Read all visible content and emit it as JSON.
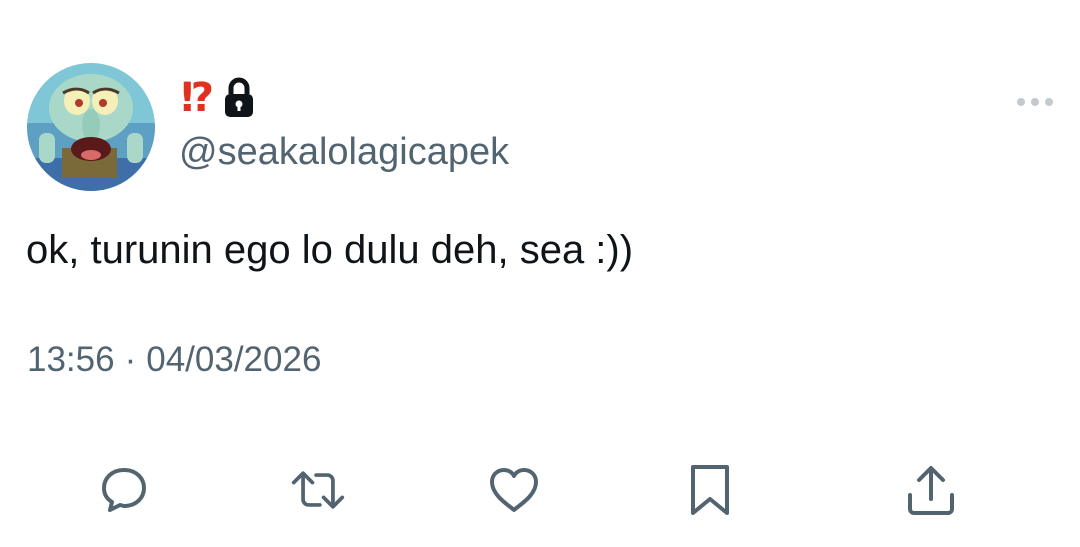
{
  "author": {
    "display_name": "⁉",
    "handle": "@seakalolagicapek",
    "protected": true,
    "avatar_icon": "squidward-avatar"
  },
  "tweet": {
    "text": "ok, turunin ego lo dulu deh, sea :))",
    "time": "13:56",
    "separator": "·",
    "date": "04/03/2026"
  },
  "actions": [
    {
      "name": "reply",
      "icon": "speech-bubble-icon"
    },
    {
      "name": "retweet",
      "icon": "retweet-arrows-icon"
    },
    {
      "name": "like",
      "icon": "heart-icon"
    },
    {
      "name": "bookmark",
      "icon": "bookmark-icon"
    },
    {
      "name": "share",
      "icon": "share-upload-icon"
    }
  ],
  "colors": {
    "text_primary": "#0f1419",
    "text_secondary": "#536471",
    "name_emoji": "#e0301e",
    "icon_gray": "#536471"
  }
}
